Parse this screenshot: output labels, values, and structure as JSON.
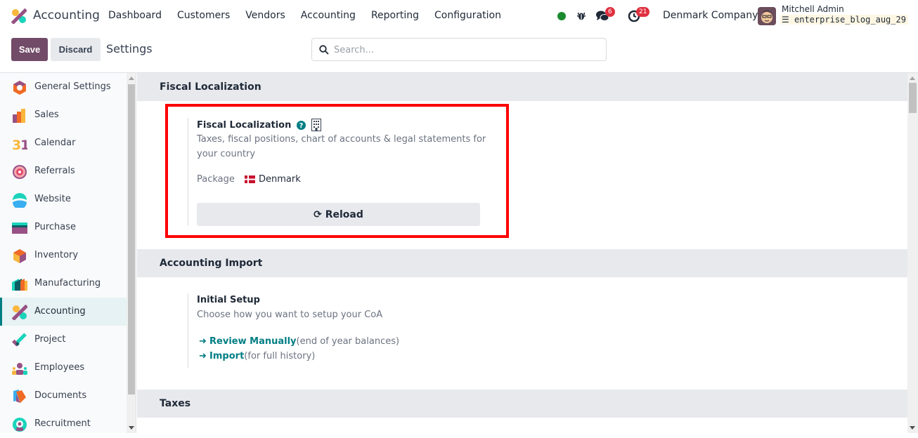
{
  "topbar": {
    "app_name": "Accounting",
    "menu": [
      "Dashboard",
      "Customers",
      "Vendors",
      "Accounting",
      "Reporting",
      "Configuration"
    ],
    "status_color": "#1c8a2e",
    "messages_count": "6",
    "activities_count": "21",
    "company": "Denmark Company",
    "user_name": "Mitchell Admin",
    "database": "enterprise_blog_aug_29"
  },
  "control": {
    "save_label": "Save",
    "discard_label": "Discard",
    "title": "Settings",
    "search_placeholder": "Search..."
  },
  "sidebar": {
    "items": [
      {
        "label": "General Settings",
        "icon": "general-settings-icon"
      },
      {
        "label": "Sales",
        "icon": "sales-icon"
      },
      {
        "label": "Calendar",
        "icon": "calendar-icon"
      },
      {
        "label": "Referrals",
        "icon": "referrals-icon"
      },
      {
        "label": "Website",
        "icon": "website-icon"
      },
      {
        "label": "Purchase",
        "icon": "purchase-icon"
      },
      {
        "label": "Inventory",
        "icon": "inventory-icon"
      },
      {
        "label": "Manufacturing",
        "icon": "manufacturing-icon"
      },
      {
        "label": "Accounting",
        "icon": "accounting-icon",
        "active": true
      },
      {
        "label": "Project",
        "icon": "project-icon"
      },
      {
        "label": "Employees",
        "icon": "employees-icon"
      },
      {
        "label": "Documents",
        "icon": "documents-icon"
      },
      {
        "label": "Recruitment",
        "icon": "recruitment-icon"
      }
    ]
  },
  "sections": {
    "fiscal": {
      "header": "Fiscal Localization",
      "title": "Fiscal Localization",
      "desc_line1": "Taxes, fiscal positions, chart of accounts & legal statements for",
      "desc_line2": "your country",
      "package_label": "Package",
      "package_value": "Denmark",
      "reload_label": "Reload"
    },
    "import": {
      "header": "Accounting Import",
      "title": "Initial Setup",
      "desc": "Choose how you want to setup your CoA",
      "link1": "Review Manually",
      "link1_note": "(end of year balances)",
      "link2": "Import",
      "link2_note": "(for full history)"
    },
    "taxes": {
      "header": "Taxes"
    }
  },
  "colors": {
    "brand": "#714B67",
    "accent": "#017e84",
    "highlight": "#ff0000"
  }
}
